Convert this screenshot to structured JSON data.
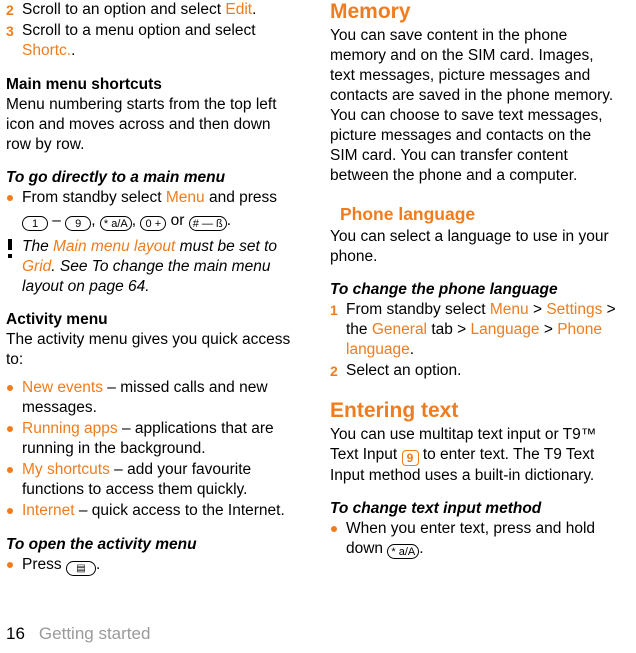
{
  "footer": {
    "page_number": "16",
    "chapter": "Getting started"
  },
  "left": {
    "steps": [
      {
        "num": "2",
        "parts": [
          {
            "t": "Scroll to an option and select ",
            "c": "black"
          },
          {
            "t": "Edit",
            "c": "orange"
          },
          {
            "t": ".",
            "c": "black"
          }
        ]
      },
      {
        "num": "3",
        "parts": [
          {
            "t": "Scroll to a menu option and select ",
            "c": "black"
          },
          {
            "t": "Shortc.",
            "c": "orange"
          },
          {
            "t": ".",
            "c": "black"
          }
        ]
      }
    ],
    "main_menu_shortcuts_heading": "Main menu shortcuts",
    "main_menu_shortcuts_body": "Menu numbering starts from the top left icon and moves across and then down row by row.",
    "go_directly_heading": "To go directly to a main menu",
    "go_directly_bullet_pre": "From standby select ",
    "go_directly_bullet_link": "Menu",
    "go_directly_bullet_post": " and press",
    "keys": {
      "one": "1",
      "nine": "9",
      "star": "* a/A",
      "zero": "0 +",
      "hash": "# — ß",
      "dash": " – ",
      "comma1": ", ",
      "comma2": ", ",
      "or": " or ",
      "period": "."
    },
    "note": {
      "pre": "The ",
      "link": "Main menu layout",
      "mid": " must be set to ",
      "link2": "Grid",
      "post": ". See To change the main menu layout on page 64."
    },
    "activity_menu_heading": "Activity menu",
    "activity_menu_body": "The activity menu gives you quick access to:",
    "activity_items": [
      {
        "link": "New events",
        "text": " – missed calls and new messages."
      },
      {
        "link": "Running apps",
        "text": " – applications that are running in the background."
      },
      {
        "link": "My shortcuts",
        "text": " – add your favourite functions to access them quickly."
      },
      {
        "link": "Internet",
        "text": " – quick access to the Internet."
      }
    ],
    "open_activity_heading": "To open the activity menu",
    "open_activity_press": "Press ",
    "open_activity_key": "▤",
    "open_activity_period": "."
  },
  "right": {
    "memory_heading": "Memory",
    "memory_body": "You can save content in the phone memory and on the SIM card. Images, text messages, picture messages and contacts are saved in the phone memory. You can choose to save text messages, picture messages and contacts on the SIM card. You can transfer content between the phone and a computer.",
    "phone_language_heading": "Phone language",
    "phone_language_body": "You can select a language to use in your phone.",
    "change_language_heading": "To change the phone language",
    "change_language_steps": [
      {
        "num": "1",
        "parts": [
          {
            "t": "From standby select ",
            "c": "black"
          },
          {
            "t": "Menu",
            "c": "orange"
          },
          {
            "t": " > ",
            "c": "black"
          },
          {
            "t": "Settings",
            "c": "orange"
          },
          {
            "t": " > the ",
            "c": "black"
          },
          {
            "t": "General",
            "c": "orange"
          },
          {
            "t": " tab > ",
            "c": "black"
          },
          {
            "t": "Language",
            "c": "orange"
          },
          {
            "t": " > ",
            "c": "black"
          },
          {
            "t": "Phone language",
            "c": "orange"
          },
          {
            "t": ".",
            "c": "black"
          }
        ]
      },
      {
        "num": "2",
        "parts": [
          {
            "t": "Select an option.",
            "c": "black"
          }
        ]
      }
    ],
    "entering_text_heading": "Entering text",
    "entering_text_pre": "You can use multitap text input or T9™ Text Input ",
    "entering_text_icon": "9",
    "entering_text_post": " to enter text. The T9 Text Input method uses a built-in dictionary.",
    "change_input_heading": "To change text input method",
    "change_input_pre": "When you enter text, press and hold down ",
    "change_input_key": "* a/A",
    "change_input_post": "."
  },
  "colors": {
    "accent": "#F07C1E",
    "footer_gray": "#9a9a9a",
    "text": "#000000"
  }
}
